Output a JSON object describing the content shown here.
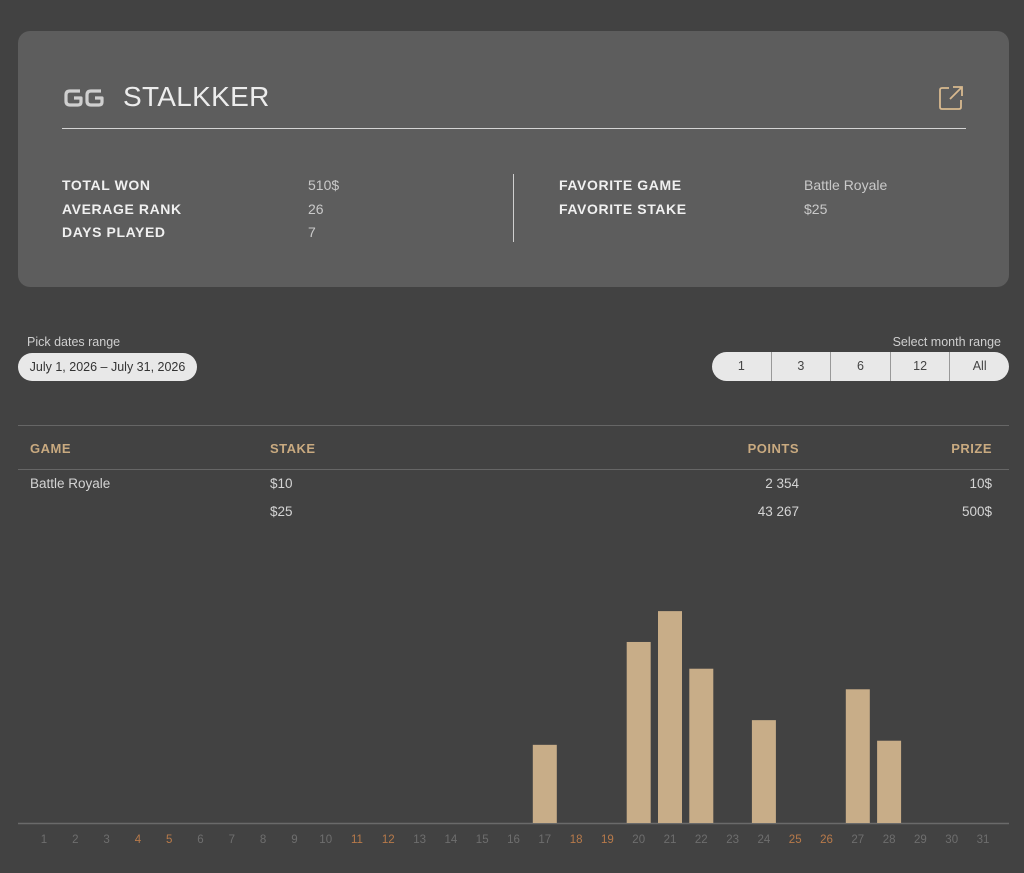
{
  "profile": {
    "logo_icon": "gg-poker-logo-icon",
    "player_name": "STALKKER",
    "external_link_icon": "external-link-icon",
    "stats_left": [
      {
        "label": "TOTAL WON",
        "value": "510$"
      },
      {
        "label": "AVERAGE RANK",
        "value": "26"
      },
      {
        "label": "DAYS PLAYED",
        "value": "7"
      }
    ],
    "stats_right": [
      {
        "label": "FAVORITE GAME",
        "value": "Battle Royale"
      },
      {
        "label": "FAVORITE STAKE",
        "value": "$25"
      }
    ]
  },
  "filters": {
    "dates_label": "Pick dates range",
    "dates_value": "July 1, 2026 – July 31, 2026",
    "month_label": "Select month range",
    "month_options": [
      "1",
      "3",
      "6",
      "12",
      "All"
    ]
  },
  "table": {
    "headers": {
      "game": "GAME",
      "stake": "STAKE",
      "points": "POINTS",
      "prize": "PRIZE"
    },
    "rows": [
      {
        "game": "Battle Royale",
        "stake": "$10",
        "points": "2 354",
        "prize": "10$"
      },
      {
        "game": "",
        "stake": "$25",
        "points": "43 267",
        "prize": "500$"
      }
    ]
  },
  "colors": {
    "background": "#424242",
    "card": "#5d5d5d",
    "accent": "#c9aa80",
    "bar": "#c8ad88",
    "weekend_label": "#b87a4a",
    "day_label": "#6e6e6e"
  },
  "chart_data": {
    "type": "bar",
    "categories": [
      "1",
      "2",
      "3",
      "4",
      "5",
      "6",
      "7",
      "8",
      "9",
      "10",
      "11",
      "12",
      "13",
      "14",
      "15",
      "16",
      "17",
      "18",
      "19",
      "20",
      "21",
      "22",
      "23",
      "24",
      "25",
      "26",
      "27",
      "28",
      "29",
      "30",
      "31"
    ],
    "weekend_days": [
      "4",
      "5",
      "11",
      "12",
      "18",
      "19",
      "25",
      "26"
    ],
    "values": [
      0,
      0,
      0,
      0,
      0,
      0,
      0,
      0,
      0,
      0,
      0,
      0,
      0,
      0,
      0,
      0,
      38,
      0,
      0,
      88,
      103,
      75,
      0,
      50,
      0,
      0,
      65,
      40,
      0,
      0,
      0
    ],
    "ylim": [
      0,
      105
    ],
    "title": "",
    "xlabel": "",
    "ylabel": ""
  }
}
